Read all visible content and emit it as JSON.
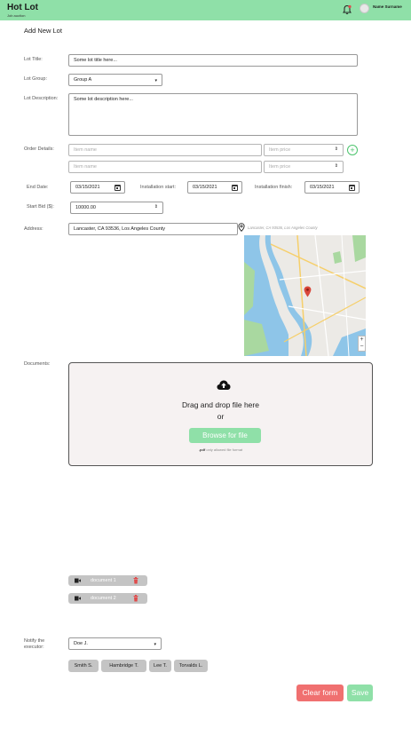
{
  "header": {
    "app_title": "Hot Lot",
    "app_subtitle": "Job auction",
    "user_name": "Name Surname",
    "bell_icon": "bell-icon",
    "accent_color": "#8fe0a8"
  },
  "page": {
    "title": "Add New Lot"
  },
  "form": {
    "lot_title": {
      "label": "Lot Title:",
      "value": "Some lot title here..."
    },
    "lot_group": {
      "label": "Lot Group:",
      "value": "Group A"
    },
    "lot_description": {
      "label": "Lot Description:",
      "value": "Some lot description here..."
    },
    "order_details": {
      "label": "Order Details:",
      "rows": [
        {
          "name_placeholder": "Item name",
          "price_placeholder": "Item price"
        },
        {
          "name_placeholder": "Item name",
          "price_placeholder": "Item price"
        }
      ],
      "add_icon": "plus-circle-icon"
    },
    "end_date": {
      "label": "End Date:",
      "value": "03/15/2021"
    },
    "installation_start": {
      "label": "Installation start:",
      "value": "03/15/2021"
    },
    "installation_finish": {
      "label": "Installation finish:",
      "value": "03/15/2021"
    },
    "start_bid": {
      "label": "Start Bid ($):",
      "value": "10000.00"
    },
    "address": {
      "label": "Address:",
      "value": "Lancaster, CA 93536, Los Angeles County",
      "hint": "Lancaster, CA 93536, Los Angeles County"
    },
    "documents": {
      "label": "Documents:",
      "drop_text": "Drag and drop file here",
      "or_text": "or",
      "browse_label": "Browse for file",
      "note_bold": ".pdf",
      "note_rest": " only allowed file format",
      "files": [
        "document 1",
        "document 2"
      ]
    },
    "notify": {
      "label_line1": "Notify the",
      "label_line2": "executor:",
      "value": "Doe J.",
      "tags": [
        "Smith S.",
        "Hambridge T.",
        "Lee T.",
        "Torvalds L."
      ]
    }
  },
  "actions": {
    "clear_label": "Clear form",
    "save_label": "Save"
  },
  "map": {
    "zoom_in": "+",
    "zoom_out": "−"
  }
}
